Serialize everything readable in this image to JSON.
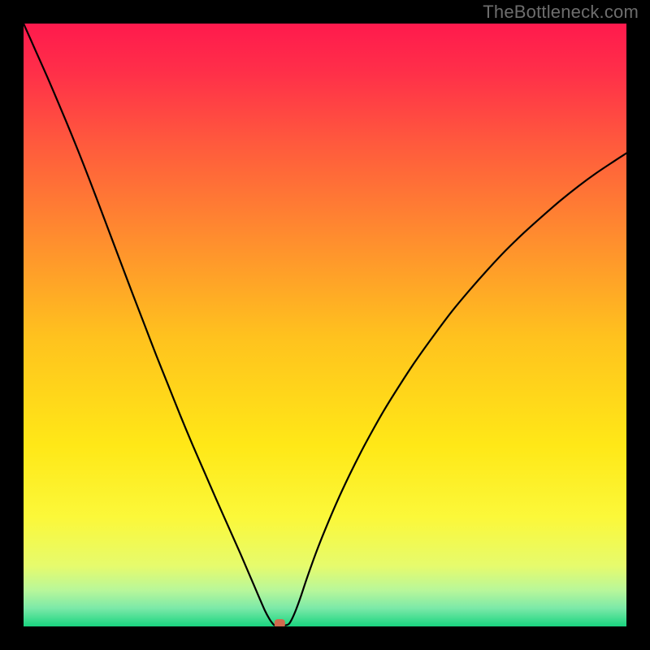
{
  "watermark": "TheBottleneck.com",
  "chart_data": {
    "type": "line",
    "title": "",
    "xlabel": "",
    "ylabel": "",
    "xlim": [
      0,
      100
    ],
    "ylim": [
      0,
      100
    ],
    "background_gradient_stops": [
      {
        "offset": 0.0,
        "color": "#ff1a4d"
      },
      {
        "offset": 0.08,
        "color": "#ff2f49"
      },
      {
        "offset": 0.2,
        "color": "#ff5a3d"
      },
      {
        "offset": 0.35,
        "color": "#ff8b2f"
      },
      {
        "offset": 0.52,
        "color": "#ffc21e"
      },
      {
        "offset": 0.7,
        "color": "#ffe817"
      },
      {
        "offset": 0.82,
        "color": "#fbf83a"
      },
      {
        "offset": 0.9,
        "color": "#e6fb6d"
      },
      {
        "offset": 0.94,
        "color": "#b8f79a"
      },
      {
        "offset": 0.97,
        "color": "#7be9a8"
      },
      {
        "offset": 1.0,
        "color": "#19d47f"
      }
    ],
    "marker": {
      "x": 42.5,
      "y": 0,
      "color": "#d06a4e"
    },
    "series": [
      {
        "name": "curve",
        "color": "#000000",
        "points": [
          {
            "x": 0.0,
            "y": 100.0
          },
          {
            "x": 2.0,
            "y": 95.5
          },
          {
            "x": 4.0,
            "y": 91.0
          },
          {
            "x": 6.0,
            "y": 86.3
          },
          {
            "x": 8.0,
            "y": 81.5
          },
          {
            "x": 10.0,
            "y": 76.5
          },
          {
            "x": 12.0,
            "y": 71.3
          },
          {
            "x": 14.0,
            "y": 66.0
          },
          {
            "x": 16.0,
            "y": 60.7
          },
          {
            "x": 18.0,
            "y": 55.4
          },
          {
            "x": 20.0,
            "y": 50.2
          },
          {
            "x": 22.0,
            "y": 45.0
          },
          {
            "x": 24.0,
            "y": 40.0
          },
          {
            "x": 26.0,
            "y": 35.0
          },
          {
            "x": 28.0,
            "y": 30.2
          },
          {
            "x": 30.0,
            "y": 25.6
          },
          {
            "x": 32.0,
            "y": 21.0
          },
          {
            "x": 34.0,
            "y": 16.5
          },
          {
            "x": 36.0,
            "y": 12.0
          },
          {
            "x": 37.5,
            "y": 8.5
          },
          {
            "x": 39.0,
            "y": 5.0
          },
          {
            "x": 40.0,
            "y": 2.7
          },
          {
            "x": 40.8,
            "y": 1.2
          },
          {
            "x": 41.3,
            "y": 0.5
          },
          {
            "x": 41.6,
            "y": 0.2
          },
          {
            "x": 42.0,
            "y": 0.2
          },
          {
            "x": 43.0,
            "y": 0.2
          },
          {
            "x": 43.5,
            "y": 0.2
          },
          {
            "x": 44.0,
            "y": 0.4
          },
          {
            "x": 44.5,
            "y": 1.2
          },
          {
            "x": 45.2,
            "y": 2.8
          },
          {
            "x": 46.0,
            "y": 5.0
          },
          {
            "x": 47.0,
            "y": 8.0
          },
          {
            "x": 48.5,
            "y": 12.2
          },
          {
            "x": 50.0,
            "y": 16.0
          },
          {
            "x": 52.0,
            "y": 20.7
          },
          {
            "x": 54.0,
            "y": 25.0
          },
          {
            "x": 56.0,
            "y": 29.0
          },
          {
            "x": 58.0,
            "y": 32.7
          },
          {
            "x": 60.0,
            "y": 36.2
          },
          {
            "x": 62.5,
            "y": 40.2
          },
          {
            "x": 65.0,
            "y": 44.0
          },
          {
            "x": 68.0,
            "y": 48.2
          },
          {
            "x": 71.0,
            "y": 52.2
          },
          {
            "x": 74.0,
            "y": 55.8
          },
          {
            "x": 77.0,
            "y": 59.2
          },
          {
            "x": 80.0,
            "y": 62.4
          },
          {
            "x": 83.0,
            "y": 65.3
          },
          {
            "x": 86.0,
            "y": 68.0
          },
          {
            "x": 89.0,
            "y": 70.6
          },
          {
            "x": 92.0,
            "y": 73.0
          },
          {
            "x": 95.0,
            "y": 75.2
          },
          {
            "x": 98.0,
            "y": 77.2
          },
          {
            "x": 100.0,
            "y": 78.5
          }
        ]
      }
    ]
  }
}
